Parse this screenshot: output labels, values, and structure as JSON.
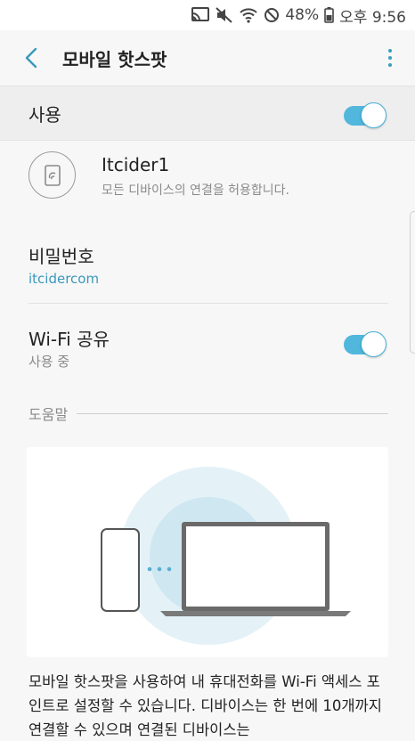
{
  "status_bar": {
    "battery_percent": "48%",
    "time": "오후 9:56",
    "icons": [
      "cast-icon",
      "mute-icon",
      "wifi-hotspot-icon",
      "blocked-icon",
      "battery-icon"
    ]
  },
  "app_bar": {
    "title": "모바일 핫스팟",
    "back_icon": "back-arrow-icon",
    "more_icon": "more-vert-icon"
  },
  "master_switch": {
    "label": "사용",
    "state": "on"
  },
  "device": {
    "name": "Itcider1",
    "subtitle": "모든 디바이스의 연결을 허용합니다."
  },
  "password": {
    "title": "비밀번호",
    "value": "itcidercom"
  },
  "wifi_share": {
    "title": "Wi-Fi 공유",
    "subtitle": "사용 중",
    "state": "on"
  },
  "help": {
    "header": "도움말",
    "text": "모바일 핫스팟을 사용하여 내 휴대전화를 Wi-Fi 액세스 포인트로 설정할 수 있습니다. 디바이스는 한 번에 10개까지 연결할 수 있으며 연결된 디바이스는"
  },
  "colors": {
    "accent": "#3a98bd",
    "switch_track": "#52b7dc",
    "background": "#f7f7f7"
  }
}
